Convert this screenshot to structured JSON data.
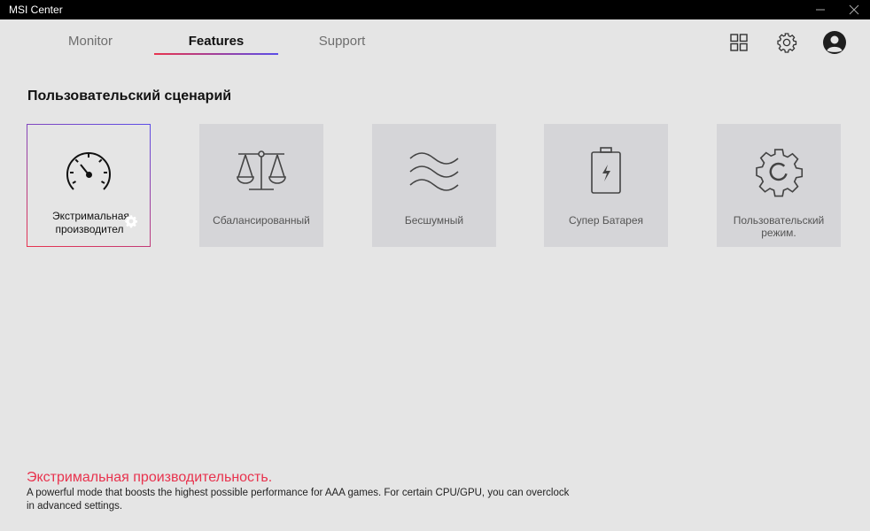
{
  "window": {
    "title": "MSI Center",
    "minimize_icon": "minimize-icon",
    "close_icon": "close-icon"
  },
  "tabs": [
    {
      "label": "Monitor",
      "active": false
    },
    {
      "label": "Features",
      "active": true
    },
    {
      "label": "Support",
      "active": false
    }
  ],
  "header_icons": [
    "grid-icon",
    "gear-icon",
    "avatar-icon"
  ],
  "section": {
    "title": "Пользовательский сценарий"
  },
  "scenarios": [
    {
      "label": "Экстримальная производител",
      "icon": "speedometer-icon",
      "selected": true
    },
    {
      "label": "Сбалансированный",
      "icon": "balance-scale-icon",
      "selected": false
    },
    {
      "label": "Бесшумный",
      "icon": "waves-icon",
      "selected": false
    },
    {
      "label": "Супер Батарея",
      "icon": "battery-icon",
      "selected": false
    },
    {
      "label": "Пользовательский режим.",
      "icon": "gear-icon",
      "selected": false
    }
  ],
  "description": {
    "title": "Экстримальная производительность.",
    "text": "A powerful mode that boosts the highest possible performance for AAA games. For certain CPU/GPU, you can overclock in advanced settings."
  },
  "colors": {
    "accent_red": "#e8334e",
    "accent_blue": "#5a4de8",
    "background": "#e5e5e5",
    "card": "#d5d5d8",
    "titlebar": "#000000"
  }
}
